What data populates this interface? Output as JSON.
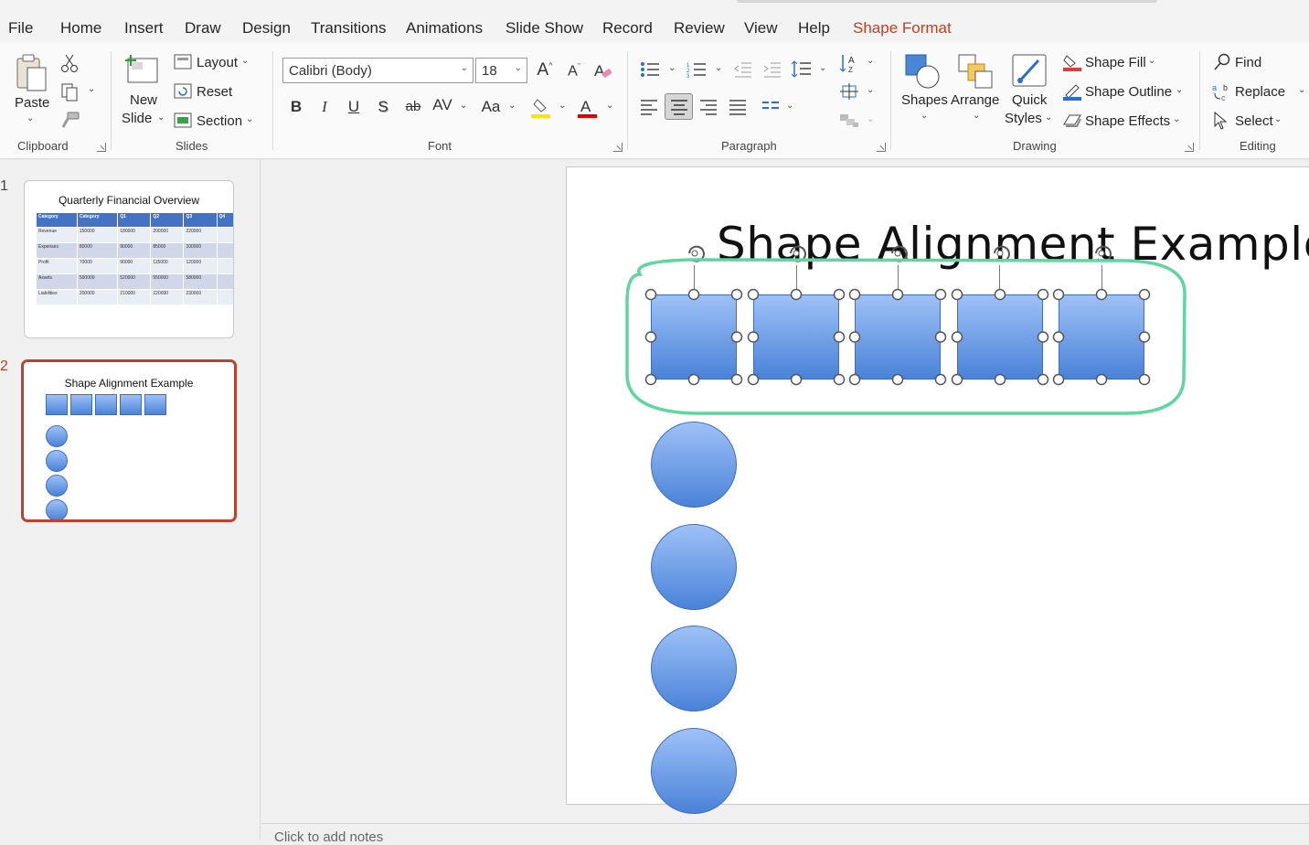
{
  "menu": {
    "tabs": [
      "File",
      "Home",
      "Insert",
      "Draw",
      "Design",
      "Transitions",
      "Animations",
      "Slide Show",
      "Record",
      "Review",
      "View",
      "Help",
      "Shape Format"
    ],
    "active": "Home",
    "contextual": "Shape Format"
  },
  "ribbon": {
    "clipboard": {
      "label": "Clipboard",
      "paste": "Paste"
    },
    "slides": {
      "label": "Slides",
      "new_slide_1": "New",
      "new_slide_2": "Slide",
      "layout": "Layout",
      "reset": "Reset",
      "section": "Section"
    },
    "font": {
      "label": "Font",
      "font_name": "Calibri (Body)",
      "font_size": "18",
      "bold": "B",
      "italic": "I",
      "underline": "U",
      "shadow": "S",
      "strike": "ab",
      "spacing": "AV",
      "case": "Aa",
      "grow": "A",
      "shrink": "A",
      "color_a": "A"
    },
    "paragraph": {
      "label": "Paragraph"
    },
    "drawing": {
      "label": "Drawing",
      "shapes": "Shapes",
      "arrange": "Arrange",
      "quick_styles_1": "Quick",
      "quick_styles_2": "Styles",
      "shape_fill": "Shape Fill",
      "shape_outline": "Shape Outline",
      "shape_effects": "Shape Effects"
    },
    "editing": {
      "label": "Editing",
      "find": "Find",
      "replace": "Replace",
      "select": "Select"
    },
    "colors": {
      "accent": "#c43e1c",
      "highlight": "#ffe600",
      "font_color": "#e00000"
    }
  },
  "slides_pane": {
    "slides": [
      {
        "number": "1",
        "title": "Quarterly Financial Overview"
      },
      {
        "number": "2",
        "title": "Shape Alignment Example"
      }
    ],
    "table": {
      "header": [
        "Category",
        "Category",
        "Q1",
        "Q2",
        "Q3",
        "Q4"
      ],
      "rows": [
        [
          "Revenue",
          "150000",
          "180000",
          "200000",
          "220000",
          ""
        ],
        [
          "Expenses",
          "80000",
          "90000",
          "85000",
          "100000",
          ""
        ],
        [
          "Profit",
          "70000",
          "90000",
          "115000",
          "120000",
          ""
        ],
        [
          "Assets",
          "500000",
          "520000",
          "550000",
          "580000",
          ""
        ],
        [
          "Liabilities",
          "200000",
          "210000",
          "220000",
          "230000",
          ""
        ]
      ]
    }
  },
  "slide": {
    "title": "Shape Alignment Example",
    "squares_selected": 5,
    "circles": 4
  },
  "notes": {
    "placeholder": "Click to add notes"
  }
}
